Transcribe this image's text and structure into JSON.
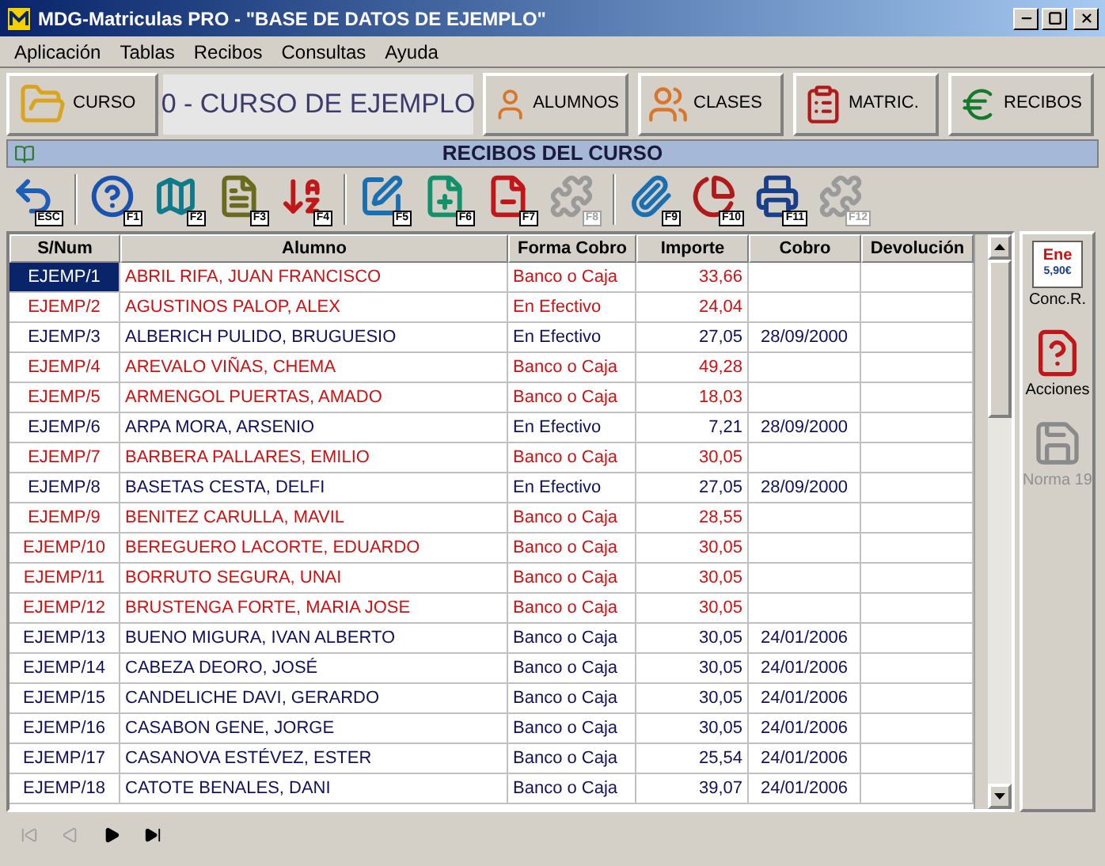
{
  "window": {
    "title": "MDG-Matriculas PRO - \"BASE DE DATOS DE EJEMPLO\""
  },
  "menu": [
    "Aplicación",
    "Tablas",
    "Recibos",
    "Consultas",
    "Ayuda"
  ],
  "course_button": {
    "label": "CURSO"
  },
  "course_name": "0 - CURSO DE EJEMPLO",
  "module_buttons": [
    {
      "kind": "students",
      "label": "ALUMNOS"
    },
    {
      "kind": "classes",
      "label": "CLASES"
    },
    {
      "kind": "enrol",
      "label": "MATRIC."
    },
    {
      "kind": "receipts",
      "label": "RECIBOS"
    }
  ],
  "section_title": "RECIBOS DEL CURSO",
  "toolbar": [
    {
      "kind": "back",
      "key": "ESC",
      "disabled": false
    },
    {
      "kind": "help",
      "key": "F1",
      "disabled": false
    },
    {
      "kind": "map",
      "key": "F2",
      "disabled": false
    },
    {
      "kind": "notes",
      "key": "F3",
      "disabled": false
    },
    {
      "kind": "sort",
      "key": "F4",
      "disabled": false
    },
    {
      "kind": "edit",
      "key": "F5",
      "disabled": false
    },
    {
      "kind": "add",
      "key": "F6",
      "disabled": false
    },
    {
      "kind": "remove",
      "key": "F7",
      "disabled": false
    },
    {
      "kind": "blank",
      "key": "F8",
      "disabled": true
    },
    {
      "kind": "attach",
      "key": "F9",
      "disabled": false
    },
    {
      "kind": "chart",
      "key": "F10",
      "disabled": false
    },
    {
      "kind": "print",
      "key": "F11",
      "disabled": false
    },
    {
      "kind": "blank",
      "key": "F12",
      "disabled": true
    }
  ],
  "table": {
    "columns": [
      "S/Num",
      "Alumno",
      "Forma Cobro",
      "Importe",
      "Cobro",
      "Devolución"
    ],
    "rows": [
      {
        "num": "EJEMP/1",
        "student": "ABRIL RIFA, JUAN FRANCISCO",
        "payment": "Banco o Caja",
        "amount": "33,66",
        "paid_on": "",
        "pending": true,
        "selected": true
      },
      {
        "num": "EJEMP/2",
        "student": "AGUSTINOS PALOP, ALEX",
        "payment": "En Efectivo",
        "amount": "24,04",
        "paid_on": "",
        "pending": true,
        "selected": false
      },
      {
        "num": "EJEMP/3",
        "student": "ALBERICH PULIDO, BRUGUESIO",
        "payment": "En Efectivo",
        "amount": "27,05",
        "paid_on": "28/09/2000",
        "pending": false,
        "selected": false
      },
      {
        "num": "EJEMP/4",
        "student": "AREVALO VIÑAS, CHEMA",
        "payment": "Banco o Caja",
        "amount": "49,28",
        "paid_on": "",
        "pending": true,
        "selected": false
      },
      {
        "num": "EJEMP/5",
        "student": "ARMENGOL PUERTAS, AMADO",
        "payment": "Banco o Caja",
        "amount": "18,03",
        "paid_on": "",
        "pending": true,
        "selected": false
      },
      {
        "num": "EJEMP/6",
        "student": "ARPA MORA, ARSENIO",
        "payment": "En Efectivo",
        "amount": "7,21",
        "paid_on": "28/09/2000",
        "pending": false,
        "selected": false
      },
      {
        "num": "EJEMP/7",
        "student": "BARBERA PALLARES, EMILIO",
        "payment": "Banco o Caja",
        "amount": "30,05",
        "paid_on": "",
        "pending": true,
        "selected": false
      },
      {
        "num": "EJEMP/8",
        "student": "BASETAS CESTA, DELFI",
        "payment": "En Efectivo",
        "amount": "27,05",
        "paid_on": "28/09/2000",
        "pending": false,
        "selected": false
      },
      {
        "num": "EJEMP/9",
        "student": "BENITEZ CARULLA, MAVIL",
        "payment": "Banco o Caja",
        "amount": "28,55",
        "paid_on": "",
        "pending": true,
        "selected": false
      },
      {
        "num": "EJEMP/10",
        "student": "BEREGUERO LACORTE, EDUARDO",
        "payment": "Banco o Caja",
        "amount": "30,05",
        "paid_on": "",
        "pending": true,
        "selected": false
      },
      {
        "num": "EJEMP/11",
        "student": "BORRUTO SEGURA, UNAI",
        "payment": "Banco o Caja",
        "amount": "30,05",
        "paid_on": "",
        "pending": true,
        "selected": false
      },
      {
        "num": "EJEMP/12",
        "student": "BRUSTENGA FORTE, MARIA JOSE",
        "payment": "Banco o Caja",
        "amount": "30,05",
        "paid_on": "",
        "pending": true,
        "selected": false
      },
      {
        "num": "EJEMP/13",
        "student": "BUENO MIGURA, IVAN ALBERTO",
        "payment": "Banco o Caja",
        "amount": "30,05",
        "paid_on": "24/01/2006",
        "pending": false,
        "selected": false
      },
      {
        "num": "EJEMP/14",
        "student": "CABEZA DEORO, JOSÉ",
        "payment": "Banco o Caja",
        "amount": "30,05",
        "paid_on": "24/01/2006",
        "pending": false,
        "selected": false
      },
      {
        "num": "EJEMP/15",
        "student": "CANDELICHE DAVI, GERARDO",
        "payment": "Banco o Caja",
        "amount": "30,05",
        "paid_on": "24/01/2006",
        "pending": false,
        "selected": false
      },
      {
        "num": "EJEMP/16",
        "student": "CASABON GENE, JORGE",
        "payment": "Banco o Caja",
        "amount": "30,05",
        "paid_on": "24/01/2006",
        "pending": false,
        "selected": false
      },
      {
        "num": "EJEMP/17",
        "student": "CASANOVA ESTÉVEZ, ESTER",
        "payment": "Banco o Caja",
        "amount": "25,54",
        "paid_on": "24/01/2006",
        "pending": false,
        "selected": false
      },
      {
        "num": "EJEMP/18",
        "student": "CATOTE BENALES, DANI",
        "payment": "Banco o Caja",
        "amount": "39,07",
        "paid_on": "24/01/2006",
        "pending": false,
        "selected": false
      }
    ]
  },
  "side_actions": [
    {
      "kind": "reconcile",
      "label": "Conc.R.",
      "badge_lines": [
        "Ene",
        "5,90€"
      ],
      "disabled": false
    },
    {
      "kind": "actions",
      "label": "Acciones",
      "disabled": false
    },
    {
      "kind": "norma",
      "label": "Norma 19",
      "disabled": true
    }
  ],
  "record_nav": [
    {
      "kind": "first",
      "disabled": true
    },
    {
      "kind": "prev",
      "disabled": true
    },
    {
      "kind": "next",
      "disabled": false
    },
    {
      "kind": "last",
      "disabled": false
    }
  ]
}
